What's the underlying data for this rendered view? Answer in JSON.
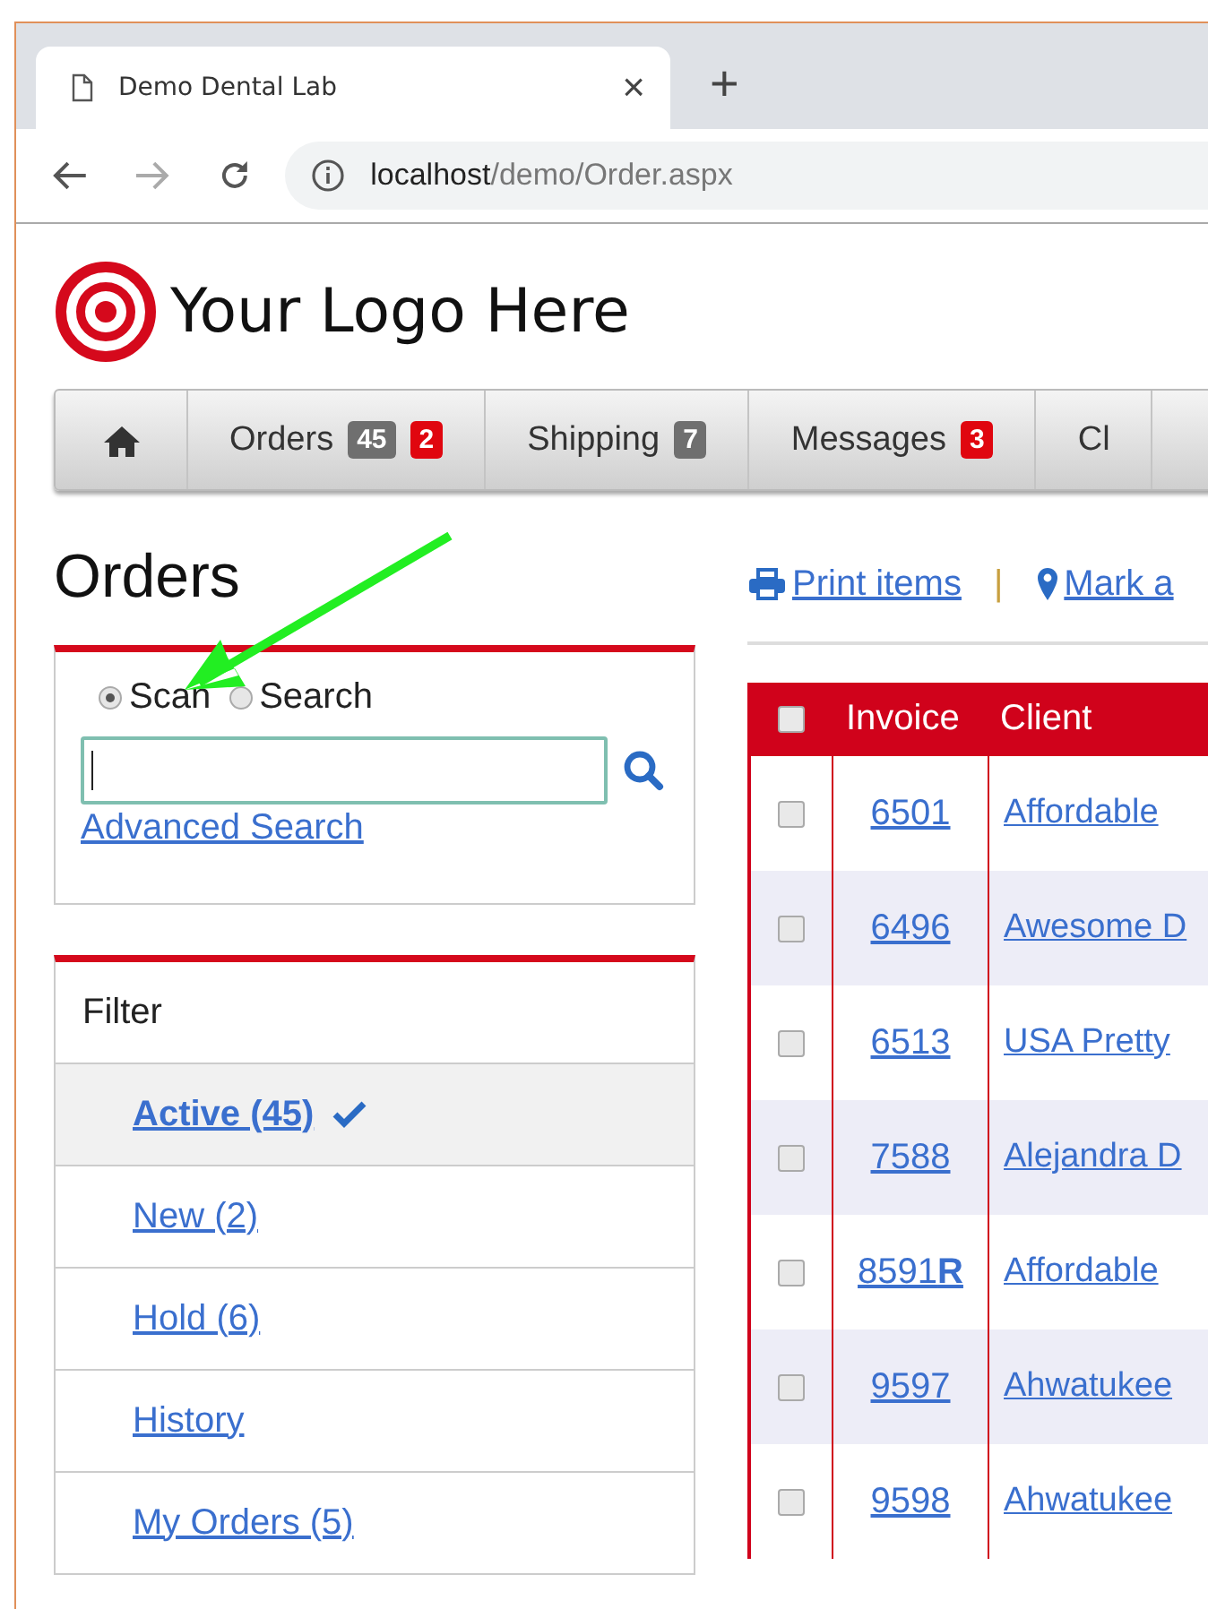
{
  "browser": {
    "tab_title": "Demo Dental Lab",
    "close": "×",
    "new_tab": "+",
    "url_host": "localhost",
    "url_path": "/demo/Order.aspx"
  },
  "logo": {
    "text": "Your Logo Here"
  },
  "nav": [
    {
      "kind": "home"
    },
    {
      "kind": "link",
      "label": "Orders",
      "badges": [
        {
          "text": "45",
          "color": "#6f6f6f"
        },
        {
          "text": "2",
          "color": "#e0060f"
        }
      ]
    },
    {
      "kind": "link",
      "label": "Shipping",
      "badges": [
        {
          "text": "7",
          "color": "#6f6f6f"
        }
      ]
    },
    {
      "kind": "link",
      "label": "Messages",
      "badges": [
        {
          "text": "3",
          "color": "#e0060f"
        }
      ]
    },
    {
      "kind": "link",
      "label": "Cl"
    }
  ],
  "page_title": "Orders",
  "scan": {
    "modes": [
      {
        "label": "Scan",
        "selected": true
      },
      {
        "label": "Search",
        "selected": false
      }
    ],
    "advanced_link": "Advanced Search"
  },
  "filter": {
    "title": "Filter",
    "items": [
      {
        "label": "Active (45)",
        "selected": true
      },
      {
        "label": "New (2)",
        "selected": false
      },
      {
        "label": "Hold (6)",
        "selected": false
      },
      {
        "label": "History",
        "selected": false
      },
      {
        "label": "My Orders (5)",
        "selected": false
      }
    ]
  },
  "actions": [
    {
      "kind": "print",
      "label": "Print items"
    },
    {
      "kind": "separator",
      "label": "|"
    },
    {
      "kind": "pin",
      "label": "Mark a"
    }
  ],
  "table": {
    "select_all_checked": false,
    "columns": [
      "Invoice",
      "Client"
    ],
    "rows": [
      {
        "checked": false,
        "invoice": "6501",
        "client": "Affordable"
      },
      {
        "checked": false,
        "invoice": "6496",
        "client": "Awesome D"
      },
      {
        "checked": false,
        "invoice": "6513",
        "client": "USA Pretty"
      },
      {
        "checked": false,
        "invoice": "7588",
        "client": "Alejandra D"
      },
      {
        "checked": false,
        "invoice": "8591**R**",
        "client": "Affordable"
      },
      {
        "checked": false,
        "invoice": "9597",
        "client": "Ahwatukee"
      },
      {
        "checked": false,
        "invoice": "9598",
        "client": "Ahwatukee"
      }
    ]
  }
}
